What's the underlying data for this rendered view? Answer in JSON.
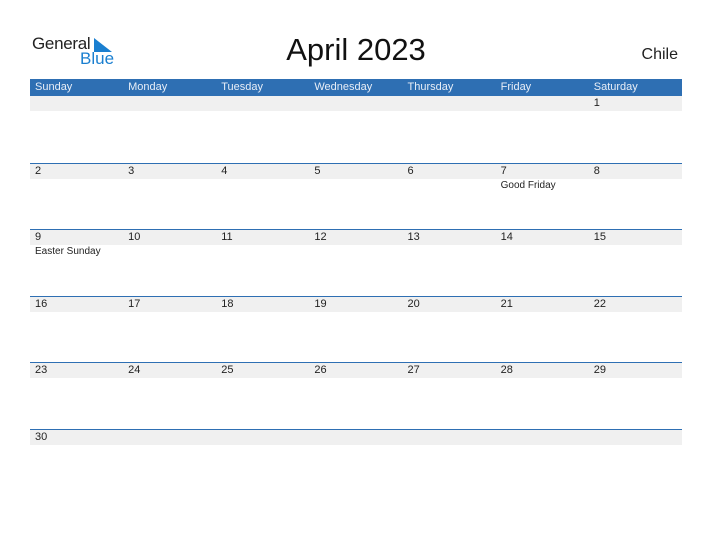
{
  "logo": {
    "general": "General",
    "blue": "Blue",
    "icon": "triangle-flag-icon",
    "accent": "#1a7fd0"
  },
  "title": "April 2023",
  "country": "Chile",
  "colors": {
    "header_bg": "#2e6fb3",
    "day_strip": "#f0f0f0"
  },
  "weekdays": [
    "Sunday",
    "Monday",
    "Tuesday",
    "Wednesday",
    "Thursday",
    "Friday",
    "Saturday"
  ],
  "weeks": [
    [
      {
        "d": ""
      },
      {
        "d": ""
      },
      {
        "d": ""
      },
      {
        "d": ""
      },
      {
        "d": ""
      },
      {
        "d": ""
      },
      {
        "d": "1"
      }
    ],
    [
      {
        "d": "2"
      },
      {
        "d": "3"
      },
      {
        "d": "4"
      },
      {
        "d": "5"
      },
      {
        "d": "6"
      },
      {
        "d": "7",
        "event": "Good Friday"
      },
      {
        "d": "8"
      }
    ],
    [
      {
        "d": "9",
        "event": "Easter Sunday"
      },
      {
        "d": "10"
      },
      {
        "d": "11"
      },
      {
        "d": "12"
      },
      {
        "d": "13"
      },
      {
        "d": "14"
      },
      {
        "d": "15"
      }
    ],
    [
      {
        "d": "16"
      },
      {
        "d": "17"
      },
      {
        "d": "18"
      },
      {
        "d": "19"
      },
      {
        "d": "20"
      },
      {
        "d": "21"
      },
      {
        "d": "22"
      }
    ],
    [
      {
        "d": "23"
      },
      {
        "d": "24"
      },
      {
        "d": "25"
      },
      {
        "d": "26"
      },
      {
        "d": "27"
      },
      {
        "d": "28"
      },
      {
        "d": "29"
      }
    ],
    [
      {
        "d": "30"
      },
      {
        "d": ""
      },
      {
        "d": ""
      },
      {
        "d": ""
      },
      {
        "d": ""
      },
      {
        "d": ""
      },
      {
        "d": ""
      }
    ]
  ]
}
